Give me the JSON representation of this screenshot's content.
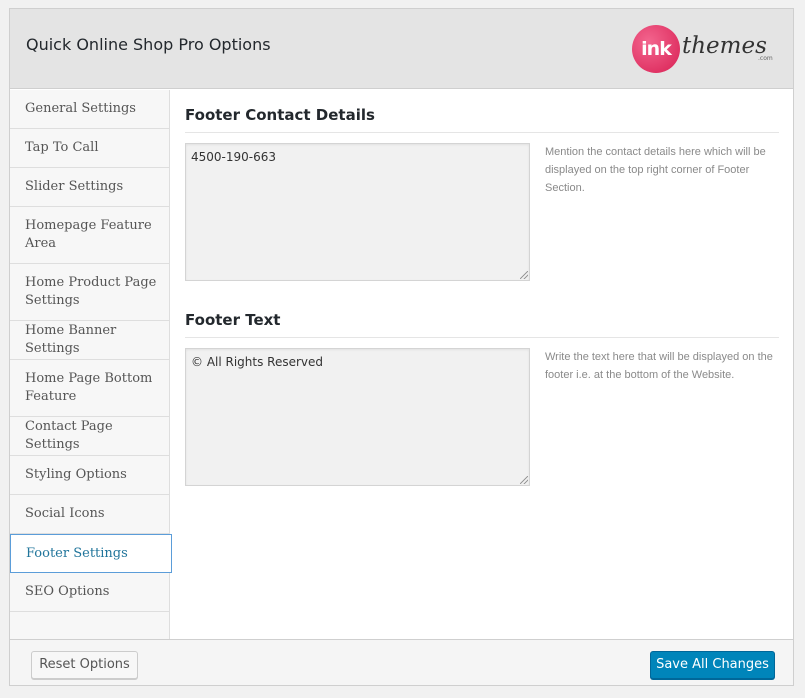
{
  "header": {
    "title": "Quick Online Shop Pro Options",
    "logo": {
      "mark": "ink",
      "word": "themes",
      "suffix": ".com"
    }
  },
  "sidebar": {
    "items": [
      {
        "label": "General Settings"
      },
      {
        "label": "Tap To Call"
      },
      {
        "label": "Slider Settings"
      },
      {
        "label": "Homepage Feature Area"
      },
      {
        "label": "Home Product Page Settings"
      },
      {
        "label": "Home Banner Settings"
      },
      {
        "label": "Home Page Bottom Feature"
      },
      {
        "label": "Contact Page Settings"
      },
      {
        "label": "Styling Options"
      },
      {
        "label": "Social Icons"
      },
      {
        "label": "Footer Settings"
      },
      {
        "label": "SEO Options"
      }
    ],
    "active": "Footer Settings"
  },
  "content": {
    "contact": {
      "title": "Footer Contact Details",
      "value": "4500-190-663",
      "description": "Mention the contact details here which will be displayed on the top right corner of Footer Section."
    },
    "footer_text": {
      "title": "Footer Text",
      "value": "© All Rights Reserved",
      "description": "Write the text here that will be displayed on the footer i.e. at the bottom of the Website."
    }
  },
  "footer": {
    "reset_label": "Reset Options",
    "save_label": "Save All Changes"
  },
  "colors": {
    "accent": "#0085ba",
    "active_nav": "#21759b",
    "logo_pink": "#e0305f"
  }
}
